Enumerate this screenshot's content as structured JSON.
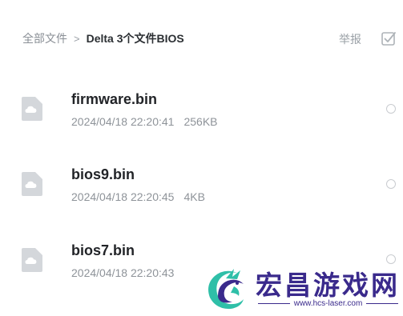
{
  "breadcrumb": {
    "root": "全部文件",
    "separator": ">",
    "current": "Delta 3个文件BIOS"
  },
  "header": {
    "report_label": "举报",
    "select_icon": "checkbox-icon"
  },
  "files": [
    {
      "name": "firmware.bin",
      "date": "2024/04/18 22:20:41",
      "size": "256KB",
      "icon": "cloud-file-icon"
    },
    {
      "name": "bios9.bin",
      "date": "2024/04/18 22:20:45",
      "size": "4KB",
      "icon": "cloud-file-icon"
    },
    {
      "name": "bios7.bin",
      "date": "2024/04/18 22:20:43",
      "size": "",
      "icon": "cloud-file-icon"
    }
  ],
  "watermark": {
    "title": "宏昌游戏网",
    "url": "www.hcs-laser.com"
  },
  "colors": {
    "file_icon": "#d4d7db",
    "select_icon": "#aeb3b8",
    "watermark": "#3a2a8c",
    "logo_teal": "#2fbfa8"
  }
}
